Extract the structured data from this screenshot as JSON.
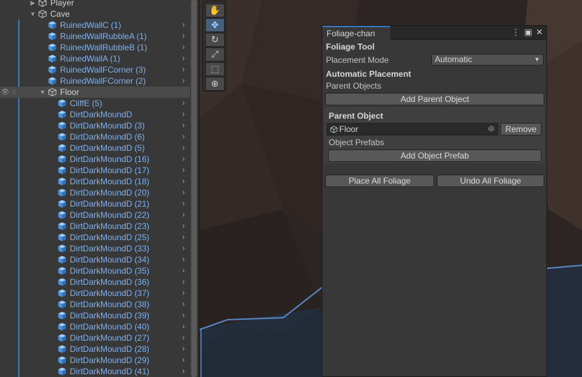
{
  "hierarchy": {
    "items": [
      {
        "label": "Player",
        "indent": 1,
        "type": "plain",
        "foldable": true,
        "expanded": false,
        "chevron": false,
        "bar": false,
        "selected": false
      },
      {
        "label": "Cave",
        "indent": 1,
        "type": "plain",
        "foldable": true,
        "expanded": true,
        "chevron": false,
        "bar": false,
        "selected": false
      },
      {
        "label": "RuinedWallC (1)",
        "indent": 2,
        "type": "prefab",
        "chevron": true,
        "bar": true
      },
      {
        "label": "RuinedWallRubbleA (1)",
        "indent": 2,
        "type": "prefab",
        "chevron": true,
        "bar": true
      },
      {
        "label": "RuinedWallRubbleB (1)",
        "indent": 2,
        "type": "prefab",
        "chevron": true,
        "bar": true
      },
      {
        "label": "RuinedWallA (1)",
        "indent": 2,
        "type": "prefab",
        "chevron": true,
        "bar": true
      },
      {
        "label": "RuinedWallFCorner (3)",
        "indent": 2,
        "type": "prefab",
        "chevron": true,
        "bar": true
      },
      {
        "label": "RuinedWallFCorner (2)",
        "indent": 2,
        "type": "prefab",
        "chevron": true,
        "bar": true
      },
      {
        "label": "Floor",
        "indent": 2,
        "type": "plain",
        "foldable": true,
        "expanded": true,
        "chevron": false,
        "bar": false,
        "selected": true,
        "visibility": true
      },
      {
        "label": "CliffE (5)",
        "indent": 3,
        "type": "prefab",
        "chevron": true,
        "bar": true
      },
      {
        "label": "DirtDarkMoundD",
        "indent": 3,
        "type": "prefab",
        "chevron": true,
        "bar": true
      },
      {
        "label": "DirtDarkMoundD (3)",
        "indent": 3,
        "type": "prefab",
        "chevron": true,
        "bar": true
      },
      {
        "label": "DirtDarkMoundD (6)",
        "indent": 3,
        "type": "prefab",
        "chevron": true,
        "bar": true
      },
      {
        "label": "DirtDarkMoundD (5)",
        "indent": 3,
        "type": "prefab",
        "chevron": true,
        "bar": true
      },
      {
        "label": "DirtDarkMoundD (16)",
        "indent": 3,
        "type": "prefab",
        "chevron": true,
        "bar": true
      },
      {
        "label": "DirtDarkMoundD (17)",
        "indent": 3,
        "type": "prefab",
        "chevron": true,
        "bar": true
      },
      {
        "label": "DirtDarkMoundD (18)",
        "indent": 3,
        "type": "prefab",
        "chevron": true,
        "bar": true
      },
      {
        "label": "DirtDarkMoundD (20)",
        "indent": 3,
        "type": "prefab",
        "chevron": true,
        "bar": true
      },
      {
        "label": "DirtDarkMoundD (21)",
        "indent": 3,
        "type": "prefab",
        "chevron": true,
        "bar": true
      },
      {
        "label": "DirtDarkMoundD (22)",
        "indent": 3,
        "type": "prefab",
        "chevron": true,
        "bar": true
      },
      {
        "label": "DirtDarkMoundD (23)",
        "indent": 3,
        "type": "prefab",
        "chevron": true,
        "bar": true
      },
      {
        "label": "DirtDarkMoundD (25)",
        "indent": 3,
        "type": "prefab",
        "chevron": true,
        "bar": true
      },
      {
        "label": "DirtDarkMoundD (33)",
        "indent": 3,
        "type": "prefab",
        "chevron": true,
        "bar": true
      },
      {
        "label": "DirtDarkMoundD (34)",
        "indent": 3,
        "type": "prefab",
        "chevron": true,
        "bar": true
      },
      {
        "label": "DirtDarkMoundD (35)",
        "indent": 3,
        "type": "prefab",
        "chevron": true,
        "bar": true
      },
      {
        "label": "DirtDarkMoundD (36)",
        "indent": 3,
        "type": "prefab",
        "chevron": true,
        "bar": true
      },
      {
        "label": "DirtDarkMoundD (37)",
        "indent": 3,
        "type": "prefab",
        "chevron": true,
        "bar": true
      },
      {
        "label": "DirtDarkMoundD (38)",
        "indent": 3,
        "type": "prefab",
        "chevron": true,
        "bar": true
      },
      {
        "label": "DirtDarkMoundD (39)",
        "indent": 3,
        "type": "prefab",
        "chevron": true,
        "bar": true
      },
      {
        "label": "DirtDarkMoundD (40)",
        "indent": 3,
        "type": "prefab",
        "chevron": true,
        "bar": true
      },
      {
        "label": "DirtDarkMoundD (27)",
        "indent": 3,
        "type": "prefab",
        "chevron": true,
        "bar": true
      },
      {
        "label": "DirtDarkMoundD (28)",
        "indent": 3,
        "type": "prefab",
        "chevron": true,
        "bar": true
      },
      {
        "label": "DirtDarkMoundD (29)",
        "indent": 3,
        "type": "prefab",
        "chevron": true,
        "bar": true
      },
      {
        "label": "DirtDarkMoundD (41)",
        "indent": 3,
        "type": "prefab",
        "chevron": true,
        "bar": true
      }
    ]
  },
  "tools": [
    {
      "name": "hand-tool",
      "icon": "hand-icon",
      "glyph": "✋",
      "active": false
    },
    {
      "name": "move-tool",
      "icon": "move-icon",
      "glyph": "✥",
      "active": true
    },
    {
      "name": "rotate-tool",
      "icon": "rotate-icon",
      "glyph": "↻",
      "active": false
    },
    {
      "name": "scale-tool",
      "icon": "scale-icon",
      "glyph": "⤢",
      "active": false
    },
    {
      "name": "rect-tool",
      "icon": "rect-icon",
      "glyph": "⬚",
      "active": false
    },
    {
      "name": "transform-tool",
      "icon": "transform-icon",
      "glyph": "⊕",
      "active": false
    }
  ],
  "foliage_window": {
    "tab_title": "Foliage-chan",
    "menu_icon": "kebab-menu-icon",
    "maximize_icon": "maximize-icon",
    "close_icon": "close-icon",
    "section_title": "Foliage Tool",
    "placement_mode": {
      "label": "Placement Mode",
      "value": "Automatic"
    },
    "automatic_heading": "Automatic Placement",
    "parent_objects_label": "Parent Objects",
    "add_parent_label": "Add Parent Object",
    "parent_object": {
      "heading": "Parent Object",
      "field_value": "Floor",
      "remove_label": "Remove",
      "prefabs_label": "Object Prefabs",
      "add_prefab_label": "Add Object Prefab"
    },
    "place_all_label": "Place All Foliage",
    "undo_all_label": "Undo All Foliage"
  },
  "colors": {
    "prefab_text": "#7fb2ef",
    "accent": "#3a79bb",
    "panel": "#383838",
    "scene_edge": "#5b86c4"
  }
}
